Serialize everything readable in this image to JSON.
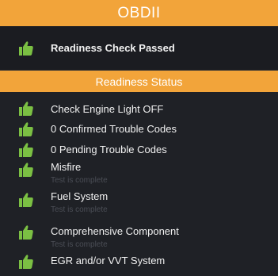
{
  "header": {
    "title": "OBDII"
  },
  "summary": {
    "text": "Readiness Check Passed",
    "icon": "thumbs-up-icon"
  },
  "section": {
    "title": "Readiness Status"
  },
  "items": [
    {
      "label": "Check Engine Light OFF",
      "sub": ""
    },
    {
      "label": "0 Confirmed Trouble Codes",
      "sub": ""
    },
    {
      "label": "0 Pending Trouble Codes",
      "sub": ""
    },
    {
      "label": "Misfire",
      "sub": "Test is complete"
    },
    {
      "label": "Fuel System",
      "sub": "Test is complete"
    },
    {
      "label": "Comprehensive Component",
      "sub": "Test is complete"
    },
    {
      "label": "EGR and/or VVT System",
      "sub": ""
    }
  ],
  "colors": {
    "accent": "#f2a43a",
    "icon": "#7bc043",
    "background": "#1f2126"
  }
}
